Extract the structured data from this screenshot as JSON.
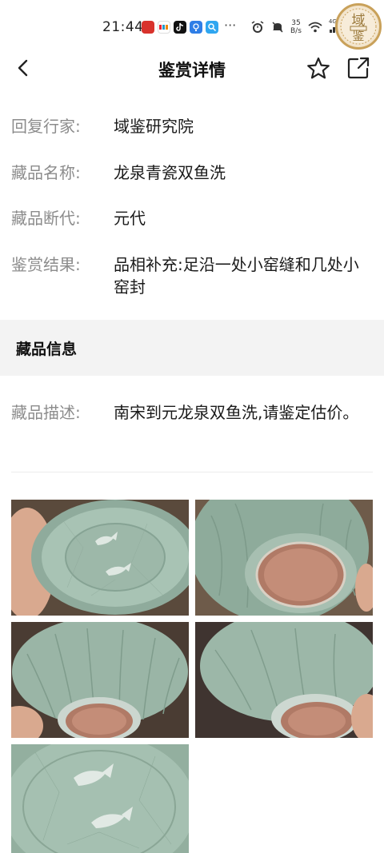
{
  "status_bar": {
    "time": "21:44",
    "net_speed_value": "35",
    "net_speed_unit": "B/s",
    "network": "4G",
    "battery": "",
    "more": "···"
  },
  "seal": {
    "text_top": "域",
    "text_bottom": "鉴"
  },
  "nav": {
    "title": "鉴赏详情"
  },
  "details": [
    {
      "label": "回复行家:",
      "value": "域鉴研究院"
    },
    {
      "label": "藏品名称:",
      "value": "龙泉青瓷双鱼洗"
    },
    {
      "label": "藏品断代:",
      "value": "元代"
    },
    {
      "label": "鉴赏结果:",
      "value": "品相补充:足沿一处小窑缝和几处小窑封"
    }
  ],
  "section": {
    "title": "藏品信息"
  },
  "description": {
    "label": "藏品描述:",
    "value": "南宋到元龙泉双鱼洗,请鉴定估价。"
  },
  "colors": {
    "celadon": "#9fb9aa",
    "celadon_dark": "#7d9a8a",
    "unglazed": "#b07a66",
    "seal_gold": "#c9a15a"
  },
  "photos": [
    {
      "name": "bowl-interior-with-fish"
    },
    {
      "name": "bowl-base-view"
    },
    {
      "name": "bowl-side-lotus-petals"
    },
    {
      "name": "bowl-base-angled"
    },
    {
      "name": "bowl-interior-fish-closeup"
    }
  ]
}
